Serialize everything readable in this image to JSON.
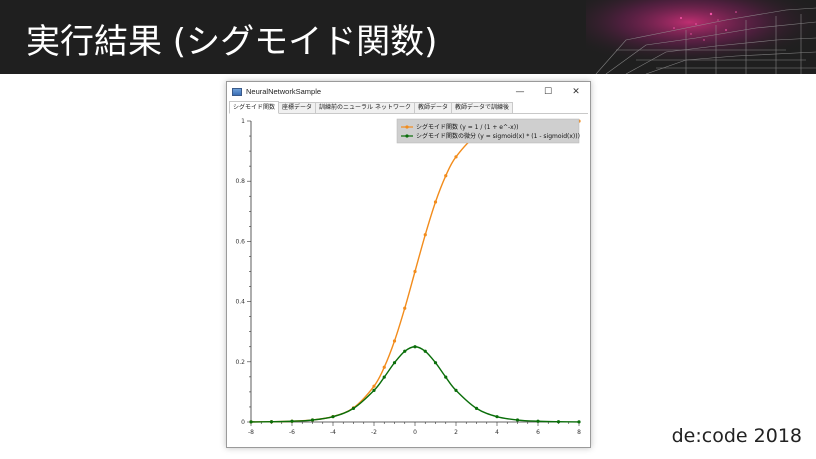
{
  "slide": {
    "title": "実行結果 (シグモイド関数)",
    "footer": "de:code 2018"
  },
  "window": {
    "title": "NeuralNetworkSample",
    "controls": {
      "minimize": "—",
      "maximize": "☐",
      "close": "✕"
    },
    "tabs": [
      {
        "label": "シグモイド関数",
        "active": true
      },
      {
        "label": "座標データ",
        "active": false
      },
      {
        "label": "訓練前のニューラル ネットワーク",
        "active": false
      },
      {
        "label": "教師データ",
        "active": false
      },
      {
        "label": "教師データで訓練後",
        "active": false
      }
    ]
  },
  "chart_data": {
    "type": "line",
    "xlim": [
      -8,
      8
    ],
    "ylim": [
      0,
      1
    ],
    "x_ticks": [
      -8,
      -6,
      -4,
      -2,
      0,
      2,
      4,
      6,
      8
    ],
    "y_ticks": [
      0,
      0.2,
      0.4,
      0.6,
      0.8,
      1
    ],
    "grid": false,
    "legend_position": "top-right",
    "series": [
      {
        "name": "シグモイド関数 (y = 1 /  (1 + e^-x))",
        "color": "#f28c1c",
        "marker": "dot",
        "x": [
          -8,
          -7,
          -6,
          -5,
          -4,
          -3,
          -2,
          -1.5,
          -1,
          -0.5,
          0,
          0.5,
          1,
          1.5,
          2,
          3,
          4,
          5,
          6,
          7,
          8
        ],
        "values": [
          0.0003,
          0.0009,
          0.0025,
          0.0067,
          0.018,
          0.047,
          0.119,
          0.182,
          0.269,
          0.378,
          0.5,
          0.622,
          0.731,
          0.818,
          0.881,
          0.953,
          0.982,
          0.993,
          0.9975,
          0.9991,
          0.9997
        ]
      },
      {
        "name": "シグモイド関数の微分 (y = sigmoid(x) * (1 - sigmoid(x)))",
        "color": "#0a6e0a",
        "marker": "dot",
        "x": [
          -8,
          -7,
          -6,
          -5,
          -4,
          -3,
          -2,
          -1.5,
          -1,
          -0.5,
          0,
          0.5,
          1,
          1.5,
          2,
          3,
          4,
          5,
          6,
          7,
          8
        ],
        "values": [
          0.0003,
          0.0009,
          0.0025,
          0.0066,
          0.0177,
          0.0452,
          0.105,
          0.149,
          0.197,
          0.235,
          0.25,
          0.235,
          0.197,
          0.149,
          0.105,
          0.0452,
          0.0177,
          0.0066,
          0.0025,
          0.0009,
          0.0003
        ]
      }
    ]
  }
}
